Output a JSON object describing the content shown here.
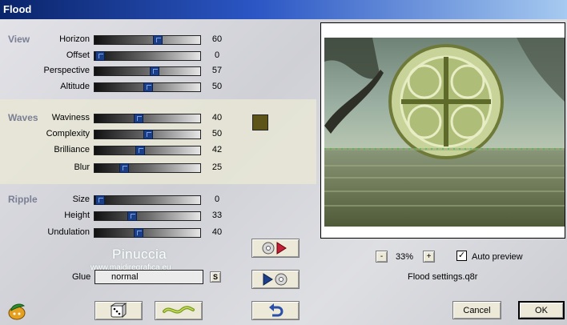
{
  "window": {
    "title": "Flood"
  },
  "sections": {
    "view": "View",
    "waves": "Waves",
    "ripple": "Ripple"
  },
  "sliders": [
    {
      "label": "Horizon",
      "value": "60",
      "level": 0.6
    },
    {
      "label": "Offset",
      "value": "0",
      "level": 0.0
    },
    {
      "label": "Perspective",
      "value": "57",
      "level": 0.57
    },
    {
      "label": "Altitude",
      "value": "50",
      "level": 0.5
    },
    {
      "label": "Waviness",
      "value": "40",
      "level": 0.4
    },
    {
      "label": "Complexity",
      "value": "50",
      "level": 0.5
    },
    {
      "label": "Brilliance",
      "value": "42",
      "level": 0.42
    },
    {
      "label": "Blur",
      "value": "25",
      "level": 0.25
    },
    {
      "label": "Size",
      "value": "0",
      "level": 0.0
    },
    {
      "label": "Height",
      "value": "33",
      "level": 0.33
    },
    {
      "label": "Undulation",
      "value": "40",
      "level": 0.4
    }
  ],
  "color_swatch": {
    "color": "#5c5418"
  },
  "watermark": {
    "name": "Pinuccia",
    "site": "www.maidiregrafica.eu"
  },
  "glue": {
    "label": "Glue",
    "value": "normal",
    "btn": "S"
  },
  "zoom": {
    "minus": "-",
    "value": "33%",
    "plus": "+"
  },
  "auto_preview": {
    "label": "Auto preview",
    "checked": true,
    "mark": "✓"
  },
  "settings_file": "Flood settings.q8r",
  "buttons": {
    "cancel": "Cancel",
    "ok": "OK"
  },
  "icons": {
    "plugin": "leaf-plugin-icon",
    "randomize": "dice-icon",
    "wave": "wave-icon",
    "reset": "undo-arrow-icon",
    "load": "load-preset-icon",
    "save": "save-preset-icon"
  }
}
